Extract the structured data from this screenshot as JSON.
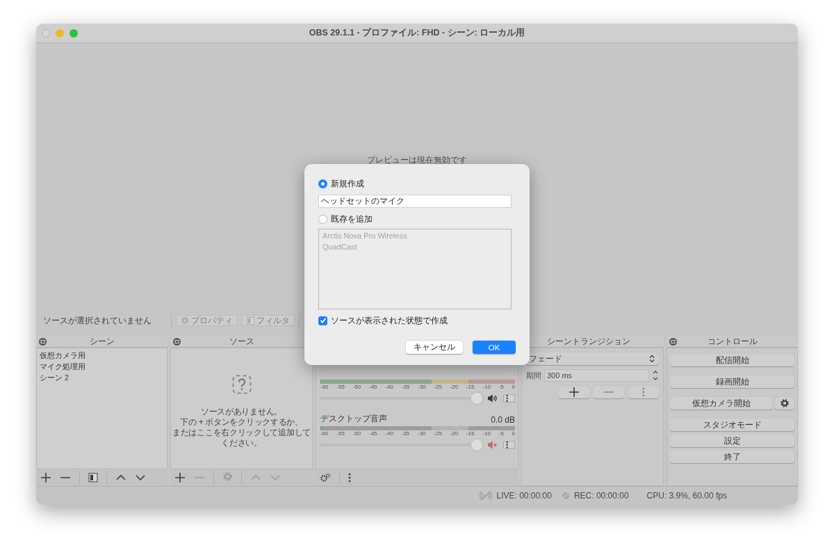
{
  "window": {
    "title": "OBS 29.1.1 - プロファイル: FHD - シーン: ローカル用"
  },
  "preview": {
    "message": "プレビューは現在無効です"
  },
  "source_bar": {
    "status": "ソースが選択されていません",
    "buttons": [
      {
        "label": "プロパティ",
        "kind": "gear",
        "disabled": true
      },
      {
        "label": "フィルタ",
        "kind": "filter",
        "disabled": true
      }
    ]
  },
  "scenes": {
    "title": "シーン",
    "items": [
      {
        "label": "仮想カメラ用",
        "selected": false
      },
      {
        "label": "マイク処理用",
        "selected": false
      },
      {
        "label": "シーン 2",
        "selected": false
      }
    ],
    "toolbar": [
      {
        "kind": "add",
        "disabled": false
      },
      {
        "kind": "remove",
        "disabled": false
      },
      {
        "kind": "filter",
        "disabled": false
      },
      {
        "kind": "up",
        "disabled": false
      },
      {
        "kind": "down",
        "disabled": false
      }
    ]
  },
  "sources": {
    "title": "ソース",
    "empty_message_lines": [
      "ソースがありません。",
      "下の + ボタンをクリックするか、",
      "またはここを右クリックして追加して",
      "ください。"
    ],
    "toolbar": [
      {
        "kind": "add",
        "disabled": false
      },
      {
        "kind": "remove",
        "disabled": true
      },
      {
        "kind": "gear",
        "disabled": true
      },
      {
        "kind": "up",
        "disabled": true
      },
      {
        "kind": "down",
        "disabled": true
      }
    ]
  },
  "mixer": {
    "channels": [
      {
        "ticks": [
          "-60",
          "-55",
          "-50",
          "-45",
          "-40",
          "-35",
          "-30",
          "-25",
          "-20",
          "-15",
          "-10",
          "-5",
          "0"
        ],
        "muted": false,
        "level": 1.0
      },
      {
        "name": "デスクトップ音声",
        "reading": "0.0 dB",
        "ticks": [
          "-60",
          "-55",
          "-50",
          "-45",
          "-40",
          "-35",
          "-30",
          "-25",
          "-20",
          "-15",
          "-10",
          "-5",
          "0"
        ],
        "muted": true,
        "level": 1.0
      }
    ]
  },
  "transitions": {
    "title": "シーントランジション",
    "selected_transition": "フェード",
    "duration_label": "期間",
    "duration_value": "300 ms"
  },
  "controls": {
    "title": "コントロール",
    "buttons": [
      {
        "label": "配信開始",
        "has_settings": false
      },
      {
        "label": "録画開始",
        "has_settings": false
      },
      {
        "label": "仮想カメラ開始",
        "has_settings": true
      },
      {
        "label": "スタジオモード",
        "has_settings": false
      },
      {
        "label": "設定",
        "has_settings": false
      },
      {
        "label": "終了",
        "has_settings": false
      }
    ]
  },
  "status_bar": {
    "live": "LIVE: 00:00:00",
    "rec": "REC: 00:00:00",
    "cpu": "CPU: 3.9%, 60.00 fps"
  },
  "dialog": {
    "new_option": {
      "label": "新規作成",
      "selected": true
    },
    "name_field": {
      "value": "ヘッドセットのマイク"
    },
    "existing_option": {
      "label": "既存を追加",
      "selected": false
    },
    "existing_list": {
      "disabled": true,
      "items": [
        {
          "label": "Arctis Nova Pro Wireless",
          "selected": false
        },
        {
          "label": "QuadCast",
          "selected": false
        }
      ]
    },
    "visible_checkbox": {
      "label": "ソースが表示された状態で作成",
      "checked": true
    },
    "buttons": [
      {
        "label": "キャンセル",
        "kind": "cancel"
      },
      {
        "label": "OK",
        "kind": "default"
      }
    ]
  }
}
